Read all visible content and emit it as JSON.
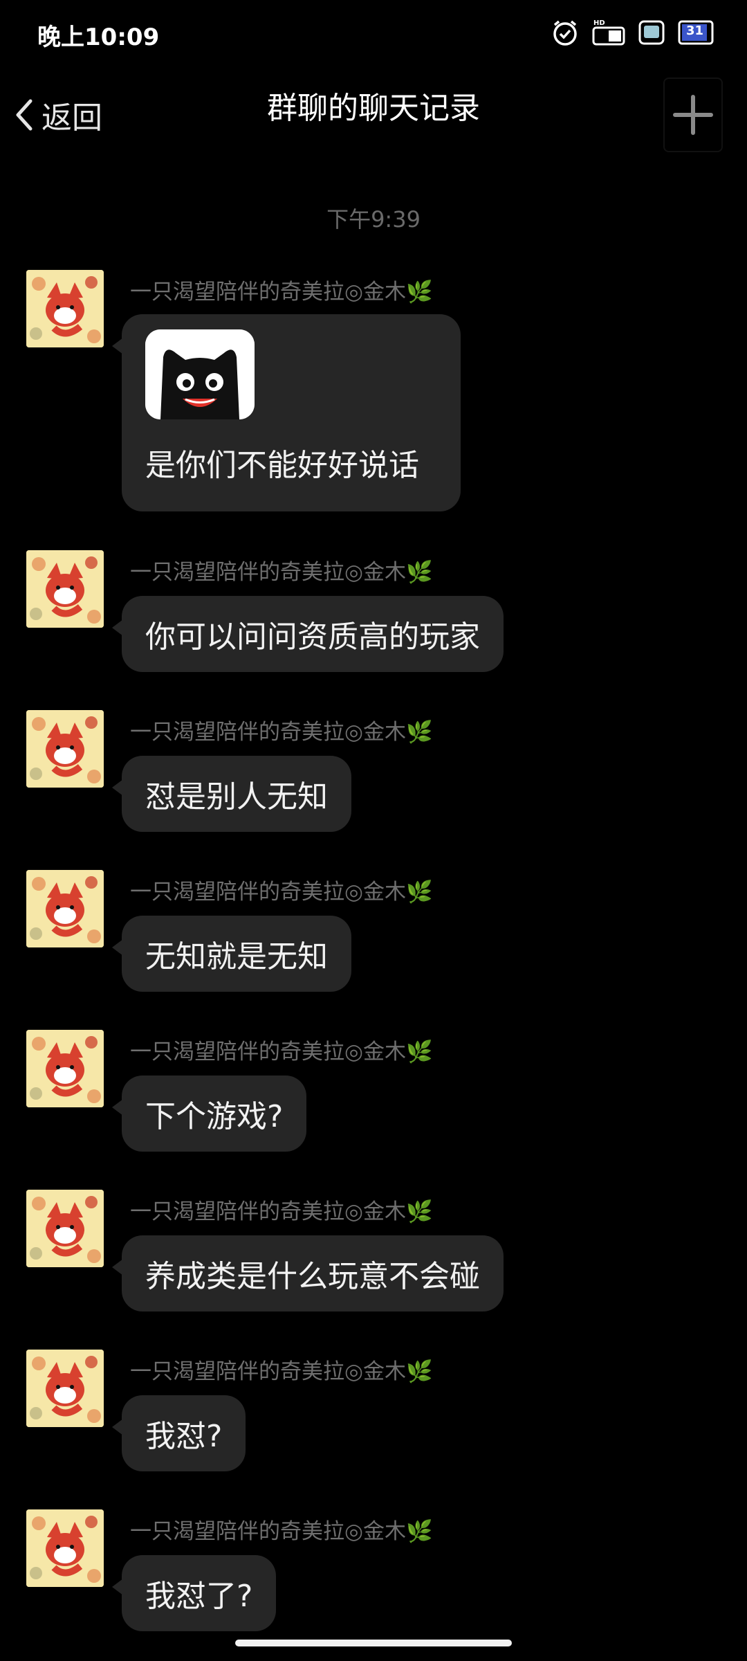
{
  "status": {
    "time": "晚上10:09",
    "battery": "31",
    "icons": [
      "alarm-icon",
      "hd-signal-icon",
      "wifi-icon",
      "battery-icon"
    ]
  },
  "nav": {
    "back_label": "返回",
    "title": "群聊的聊天记录",
    "plus_icon": "plus-icon"
  },
  "timestamp": "下午9:39",
  "sender_name": "一只渴望陪伴的奇美拉◎金木🌿",
  "messages": [
    {
      "text": "是你们不能好好说话",
      "has_sticker": true
    },
    {
      "text": "你可以问问资质高的玩家"
    },
    {
      "text": "怼是别人无知"
    },
    {
      "text": "无知就是无知"
    },
    {
      "text": "下个游戏?"
    },
    {
      "text": "养成类是什么玩意不会碰"
    },
    {
      "text": "我怼?"
    },
    {
      "text": "我怼了?"
    }
  ],
  "colors": {
    "background": "#000000",
    "bubble": "#262626",
    "sender": "#6f6f6f",
    "timestamp": "#6a6a6a"
  }
}
